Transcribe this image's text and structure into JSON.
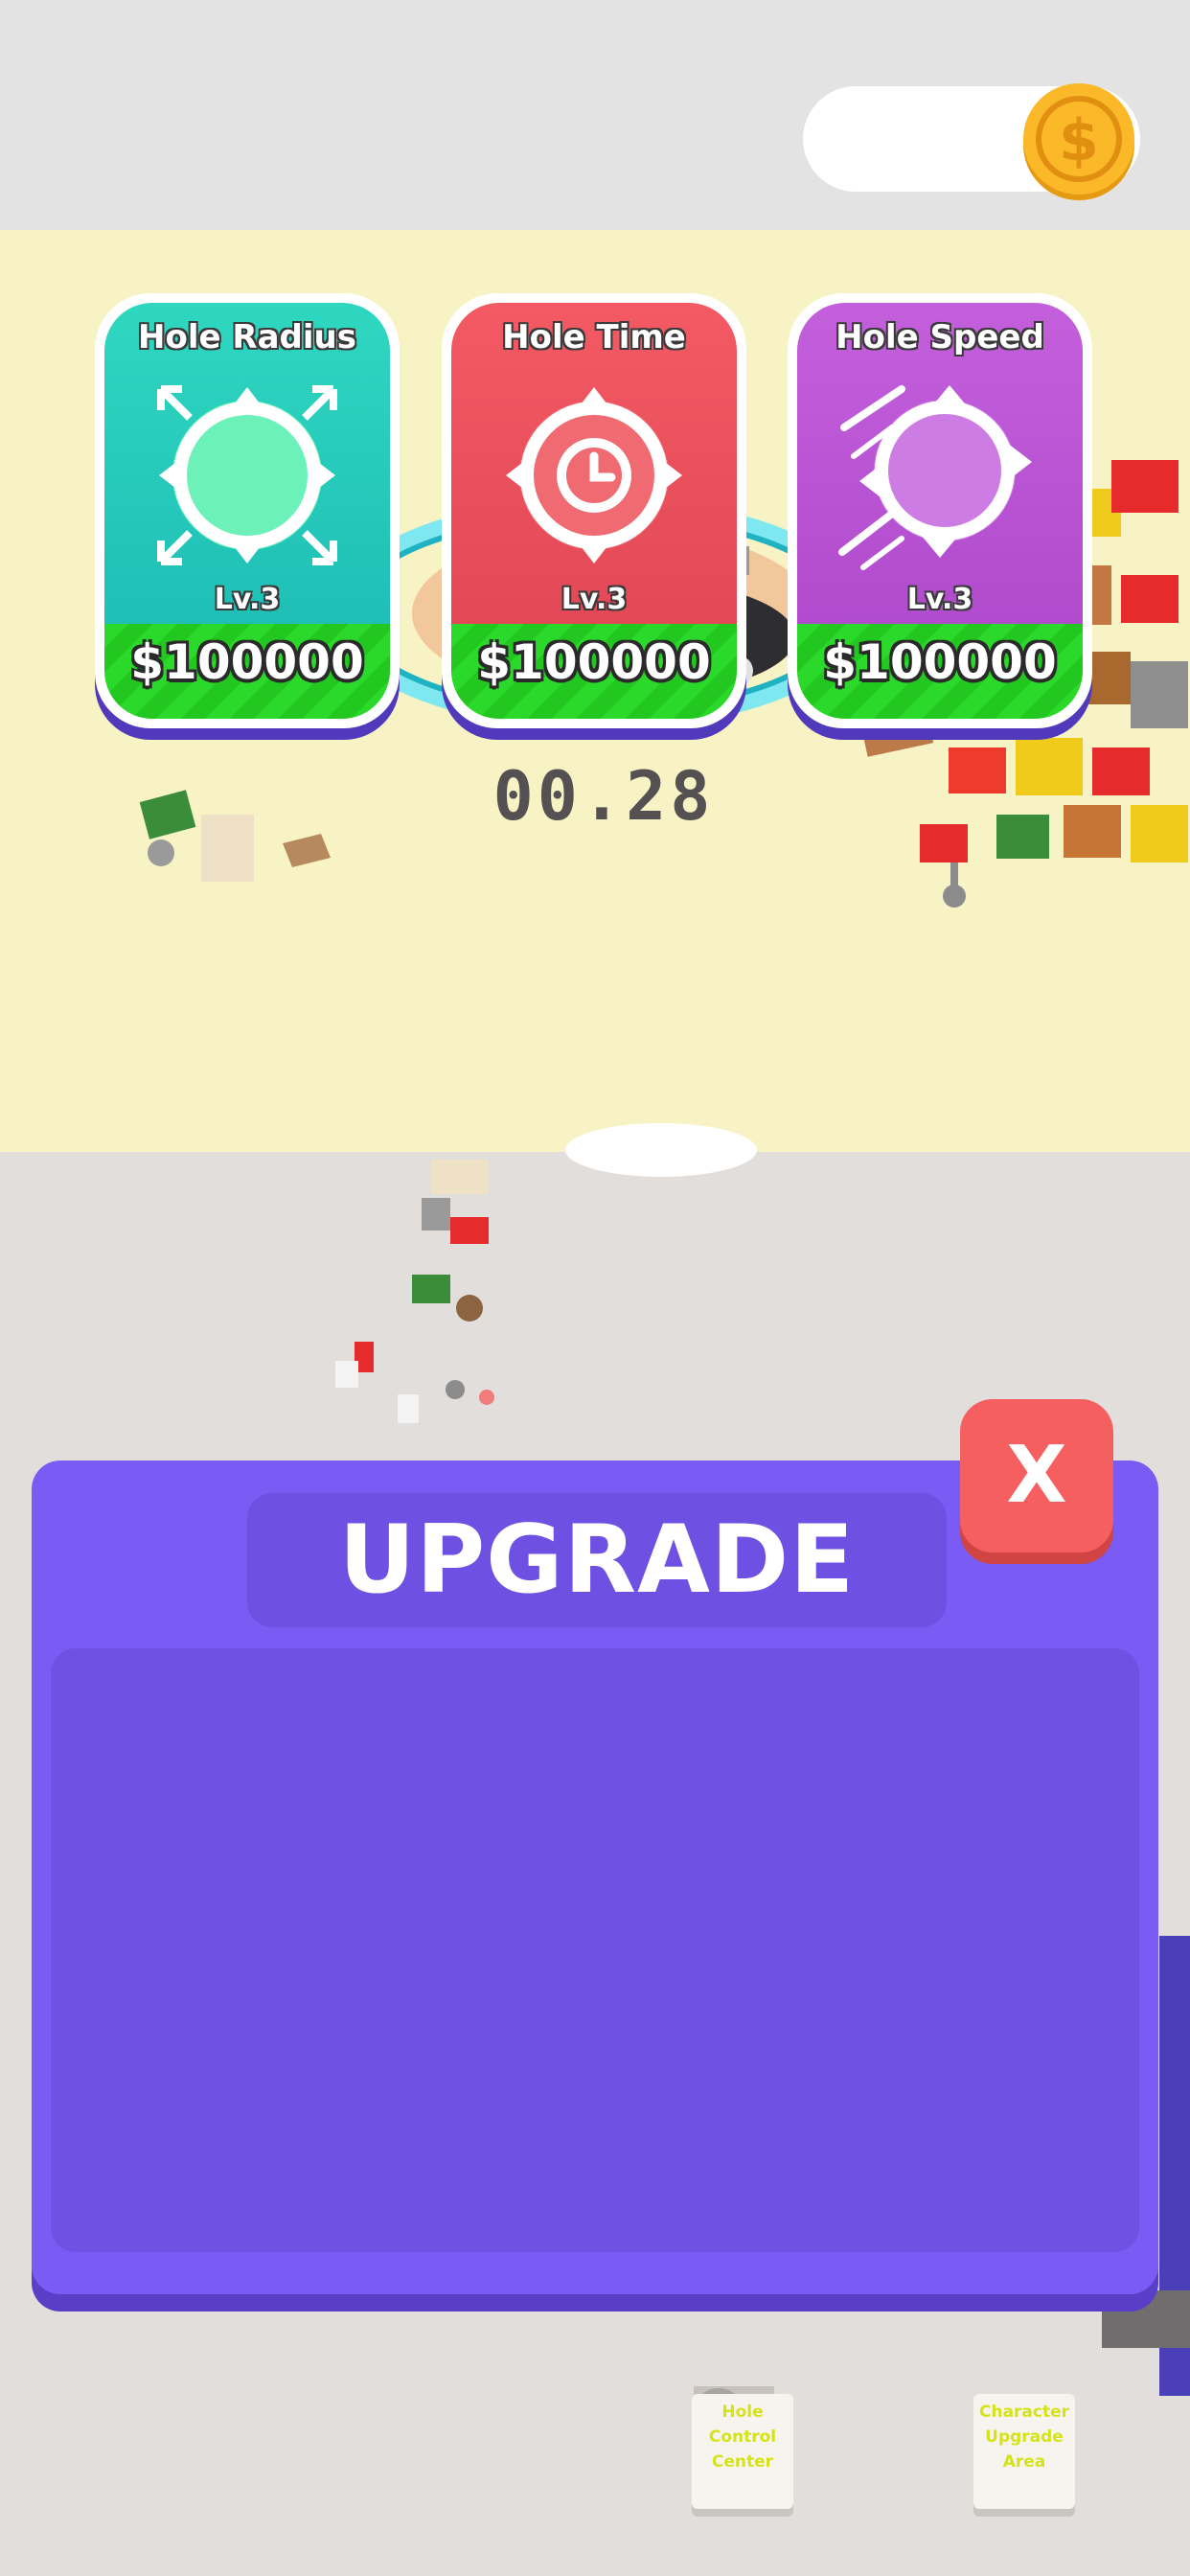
{
  "hud": {
    "coin_value": "",
    "coin_icon": "dollar-coin-icon"
  },
  "arena": {
    "timer": "00.28"
  },
  "upgrade_panel": {
    "title": "UPGRADE",
    "close_label": "X",
    "cards": [
      {
        "name": "Hole Radius",
        "level": "Lv.3",
        "price": "$100000",
        "icon": "hole-radius-icon",
        "color": "#22ccb9"
      },
      {
        "name": "Hole Time",
        "level": "Lv.3",
        "price": "$100000",
        "icon": "hole-time-icon",
        "color": "#ef525d"
      },
      {
        "name": "Hole Speed",
        "level": "Lv.3",
        "price": "$100000",
        "icon": "hole-speed-icon",
        "color": "#b54ad1"
      }
    ]
  },
  "signs": [
    {
      "text": "Hole Control Center"
    },
    {
      "text": "Character Upgrade Area"
    }
  ],
  "colors": {
    "panel": "#7a5cf4",
    "close": "#f65f5f",
    "price_bar": "#2bd92a",
    "arena": "#f8f3c4"
  }
}
